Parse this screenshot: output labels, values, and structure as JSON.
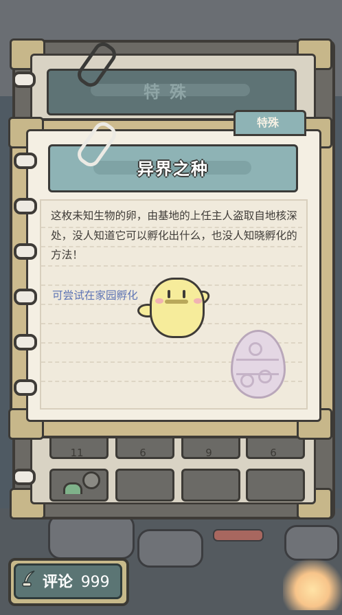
{
  "back_panel": {
    "title": "特殊",
    "slot_counts": [
      "11",
      "6",
      "9",
      "6"
    ]
  },
  "card": {
    "tab_label": "特殊",
    "title": "异界之种",
    "description": "这枚未知生物的卵，由基地的上任主人盗取自地核深处，没人知道它可以孵化出什么，也没人知晓孵化的方法！",
    "hint": "可尝试在家园孵化"
  },
  "comment_button": {
    "label": "评论",
    "count": "999"
  },
  "icons": {
    "comment": "quill-pen-icon",
    "egg": "mystery-egg-icon",
    "mascot": "chick-mascot-icon"
  },
  "colors": {
    "header_teal": "#8eb3b5",
    "hint_blue": "#5c73b4",
    "page_cream": "#f4efe3",
    "frame_tan": "#cdbb8e"
  }
}
